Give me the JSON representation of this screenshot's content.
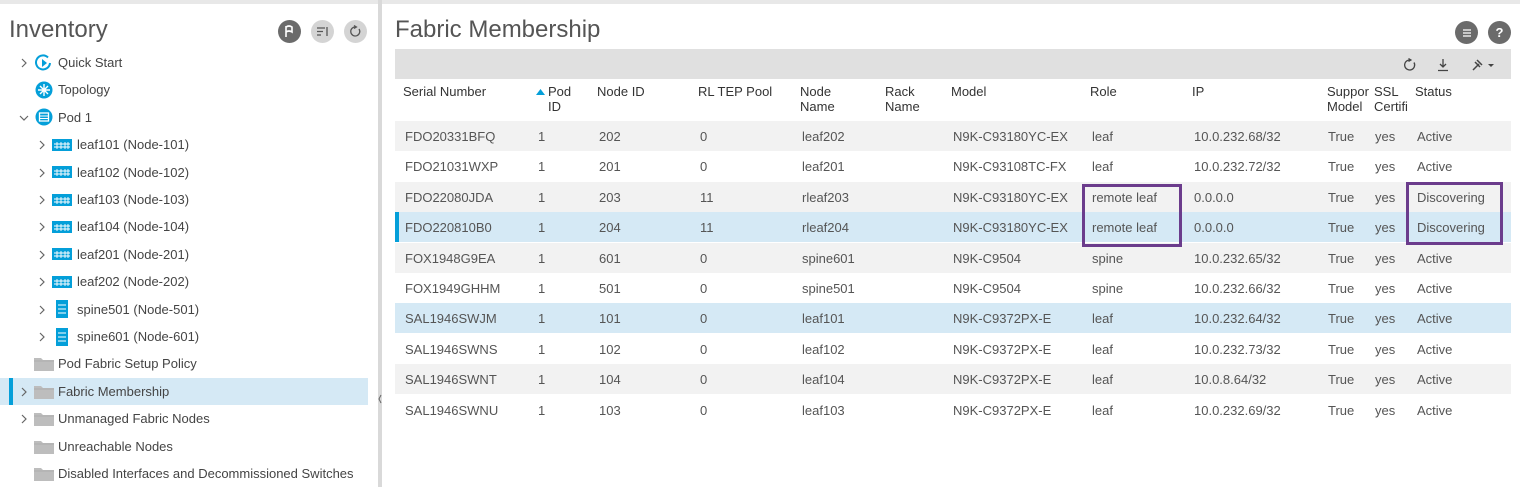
{
  "inventory": {
    "title": "Inventory",
    "tree": [
      {
        "label": "Quick Start",
        "icon": "quick-start-icon",
        "expander": "right",
        "indent": 0
      },
      {
        "label": "Topology",
        "icon": "topology-icon",
        "expander": "",
        "indent": 0
      },
      {
        "label": "Pod 1",
        "icon": "pod-icon",
        "expander": "down",
        "indent": 0
      },
      {
        "label": "leaf101 (Node-101)",
        "icon": "leaf-switch-icon",
        "expander": "right",
        "indent": 1
      },
      {
        "label": "leaf102 (Node-102)",
        "icon": "leaf-switch-icon",
        "expander": "right",
        "indent": 1
      },
      {
        "label": "leaf103 (Node-103)",
        "icon": "leaf-switch-icon",
        "expander": "right",
        "indent": 1
      },
      {
        "label": "leaf104 (Node-104)",
        "icon": "leaf-switch-icon",
        "expander": "right",
        "indent": 1
      },
      {
        "label": "leaf201 (Node-201)",
        "icon": "leaf-switch-icon",
        "expander": "right",
        "indent": 1
      },
      {
        "label": "leaf202 (Node-202)",
        "icon": "leaf-switch-icon",
        "expander": "right",
        "indent": 1
      },
      {
        "label": "spine501 (Node-501)",
        "icon": "spine-switch-icon",
        "expander": "right",
        "indent": 1
      },
      {
        "label": "spine601 (Node-601)",
        "icon": "spine-switch-icon",
        "expander": "right",
        "indent": 1
      },
      {
        "label": "Pod Fabric Setup Policy",
        "icon": "folder-icon",
        "expander": "",
        "indent": 0
      },
      {
        "label": "Fabric Membership",
        "icon": "folder-icon",
        "expander": "right",
        "indent": 0,
        "selected": true
      },
      {
        "label": "Unmanaged Fabric Nodes",
        "icon": "folder-icon",
        "expander": "right",
        "indent": 0
      },
      {
        "label": "Unreachable Nodes",
        "icon": "folder-icon",
        "expander": "",
        "indent": 0
      },
      {
        "label": "Disabled Interfaces and Decommissioned Switches",
        "icon": "folder-icon",
        "expander": "",
        "indent": 0
      }
    ]
  },
  "main": {
    "title": "Fabric Membership",
    "columns": [
      "Serial Number",
      "Pod\nID",
      "Node ID",
      "RL TEP Pool",
      "Node\nName",
      "Rack\nName",
      "Model",
      "Role",
      "IP",
      "Suppor\nModel",
      "SSL\nCertifi",
      "Status"
    ],
    "sorted_column": 1,
    "rows": [
      [
        "FDO20331BFQ",
        "1",
        "202",
        "0",
        "leaf202",
        "",
        "N9K-C93180YC-EX",
        "leaf",
        "10.0.232.68/32",
        "True",
        "yes",
        "Active"
      ],
      [
        "FDO21031WXP",
        "1",
        "201",
        "0",
        "leaf201",
        "",
        "N9K-C93108TC-FX",
        "leaf",
        "10.0.232.72/32",
        "True",
        "yes",
        "Active"
      ],
      [
        "FDO22080JDA",
        "1",
        "203",
        "11",
        "rleaf203",
        "",
        "N9K-C93180YC-EX",
        "remote leaf",
        "0.0.0.0",
        "True",
        "yes",
        "Discovering"
      ],
      [
        "FDO220810B0",
        "1",
        "204",
        "11",
        "rleaf204",
        "",
        "N9K-C93180YC-EX",
        "remote leaf",
        "0.0.0.0",
        "True",
        "yes",
        "Discovering"
      ],
      [
        "FOX1948G9EA",
        "1",
        "601",
        "0",
        "spine601",
        "",
        "N9K-C9504",
        "spine",
        "10.0.232.65/32",
        "True",
        "yes",
        "Active"
      ],
      [
        "FOX1949GHHM",
        "1",
        "501",
        "0",
        "spine501",
        "",
        "N9K-C9504",
        "spine",
        "10.0.232.66/32",
        "True",
        "yes",
        "Active"
      ],
      [
        "SAL1946SWJM",
        "1",
        "101",
        "0",
        "leaf101",
        "",
        "N9K-C9372PX-E",
        "leaf",
        "10.0.232.64/32",
        "True",
        "yes",
        "Active"
      ],
      [
        "SAL1946SWNS",
        "1",
        "102",
        "0",
        "leaf102",
        "",
        "N9K-C9372PX-E",
        "leaf",
        "10.0.232.73/32",
        "True",
        "yes",
        "Active"
      ],
      [
        "SAL1946SWNT",
        "1",
        "104",
        "0",
        "leaf104",
        "",
        "N9K-C9372PX-E",
        "leaf",
        "10.0.8.64/32",
        "True",
        "yes",
        "Active"
      ],
      [
        "SAL1946SWNU",
        "1",
        "103",
        "0",
        "leaf103",
        "",
        "N9K-C9372PX-E",
        "leaf",
        "10.0.232.69/32",
        "True",
        "yes",
        "Active"
      ]
    ],
    "selected_rows": [
      3
    ],
    "hover_rows": [
      6
    ],
    "highlight_color": "#6b3c8c",
    "selection_color": "#049fd9"
  }
}
